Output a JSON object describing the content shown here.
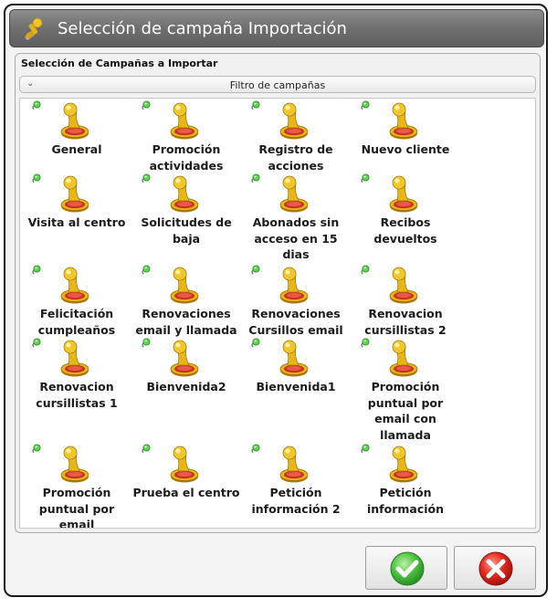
{
  "window": {
    "title": "Selección de campaña Importación"
  },
  "group": {
    "title": "Selección de Campañas a Importar"
  },
  "filter": {
    "label": "Filtro de campañas",
    "collapsed": true
  },
  "campaigns": [
    "General",
    "Promoción actividades",
    "Registro de acciones",
    "Nuevo cliente",
    "Visita al centro",
    "Solicitudes de baja",
    "Abonados sin acceso en 15 dias",
    "Recibos devueltos",
    "Felicitación cumpleaños",
    "Renovaciones email y llamada",
    "Renovaciones Cursillos email",
    "Renovacion cursillistas 2",
    "Renovacion cursillistas 1",
    "Bienvenida2",
    "Bienvenida1",
    "Promoción puntual por email con llamada",
    "Promoción puntual por email",
    "Prueba el centro",
    "Petición información 2",
    "Petición información"
  ],
  "buttons": {
    "accept_icon": "check-icon",
    "cancel_icon": "cross-icon"
  },
  "colors": {
    "accent_green": "#3fb73a",
    "accent_red": "#e0261f",
    "stamp_gold": "#e7b516",
    "titlebar": "#6f6f6f"
  }
}
